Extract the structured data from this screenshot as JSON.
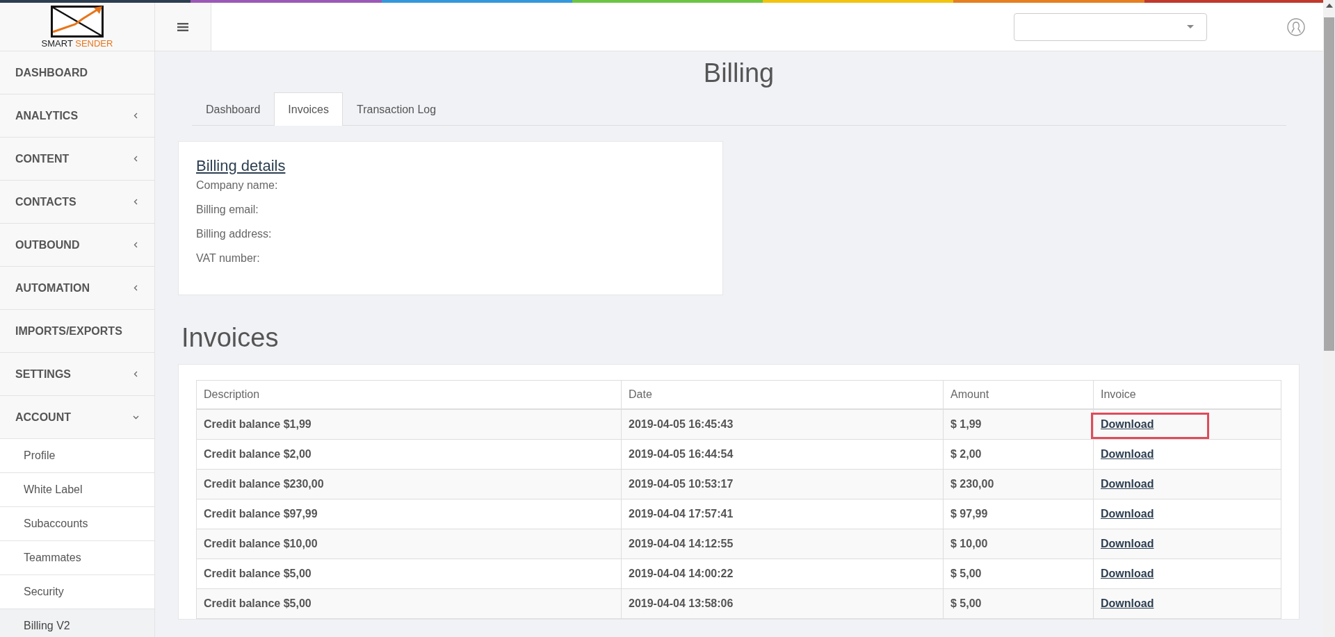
{
  "logo": {
    "word_1": "SMART",
    "word_2": "SENDER"
  },
  "sidebar": {
    "items": [
      {
        "label": "DASHBOARD"
      },
      {
        "label": "ANALYTICS",
        "expanded": false
      },
      {
        "label": "CONTENT",
        "expanded": false
      },
      {
        "label": "CONTACTS",
        "expanded": false
      },
      {
        "label": "OUTBOUND",
        "expanded": false
      },
      {
        "label": "AUTOMATION",
        "expanded": false
      },
      {
        "label": "IMPORTS/EXPORTS"
      },
      {
        "label": "SETTINGS",
        "expanded": false
      },
      {
        "label": "ACCOUNT",
        "expanded": true,
        "children": [
          {
            "label": "Profile",
            "selected": false
          },
          {
            "label": "White Label",
            "selected": false
          },
          {
            "label": "Subaccounts",
            "selected": false
          },
          {
            "label": "Teammates",
            "selected": false
          },
          {
            "label": "Security",
            "selected": false
          },
          {
            "label": "Billing V2",
            "selected": true
          }
        ]
      }
    ]
  },
  "page_title": "Billing",
  "tabs": [
    {
      "label": "Dashboard",
      "selected": false
    },
    {
      "label": "Invoices",
      "selected": true
    },
    {
      "label": "Transaction Log",
      "selected": false
    }
  ],
  "billing_details": {
    "title": "Billing details",
    "fields": [
      "Company name:",
      "Billing email:",
      "Billing address:",
      "VAT number:"
    ]
  },
  "invoices": {
    "title": "Invoices",
    "columns": [
      "Description",
      "Date",
      "Amount",
      "Invoice"
    ],
    "rows": [
      {
        "description": "Credit balance $1,99",
        "date": "2019-04-05 16:45:43",
        "amount": "$ 1,99",
        "invoice": "Download",
        "highlighted": true
      },
      {
        "description": "Credit balance $2,00",
        "date": "2019-04-05 16:44:54",
        "amount": "$ 2,00",
        "invoice": "Download",
        "highlighted": false
      },
      {
        "description": "Credit balance $230,00",
        "date": "2019-04-05 10:53:17",
        "amount": "$ 230,00",
        "invoice": "Download",
        "highlighted": false
      },
      {
        "description": "Credit balance $97,99",
        "date": "2019-04-04 17:57:41",
        "amount": "$ 97,99",
        "invoice": "Download",
        "highlighted": false
      },
      {
        "description": "Credit balance $10,00",
        "date": "2019-04-04 14:12:55",
        "amount": "$ 10,00",
        "invoice": "Download",
        "highlighted": false
      },
      {
        "description": "Credit balance $5,00",
        "date": "2019-04-04 14:00:22",
        "amount": "$ 5,00",
        "invoice": "Download",
        "highlighted": false
      },
      {
        "description": "Credit balance $5,00",
        "date": "2019-04-04 13:58:06",
        "amount": "$ 5,00",
        "invoice": "Download",
        "highlighted": false
      }
    ]
  }
}
